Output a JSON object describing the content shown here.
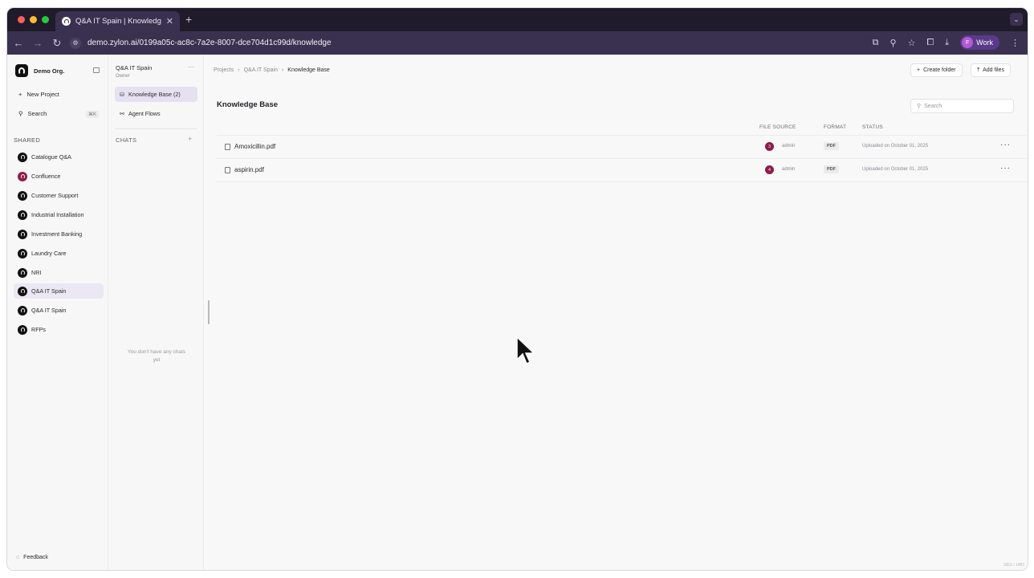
{
  "browser": {
    "tab_title": "Q&A IT Spain | Knowledge Ba",
    "url": "demo.zylon.ai/0199a05c-ac8c-7a2e-8007-dce704d1c99d/knowledge",
    "profile_initial": "F",
    "profile_label": "Work"
  },
  "sidebar": {
    "org_name": "Demo Org.",
    "new_project": "New Project",
    "search": "Search",
    "search_shortcut": "⌘K",
    "section": "SHARED",
    "projects": [
      {
        "label": "Catalogue Q&A",
        "active": false
      },
      {
        "label": "Confluence",
        "active": false
      },
      {
        "label": "Customer Support",
        "active": false
      },
      {
        "label": "Industrial Installation",
        "active": false
      },
      {
        "label": "Investment Banking",
        "active": false
      },
      {
        "label": "Laundry Care",
        "active": false
      },
      {
        "label": "NRI",
        "active": false
      },
      {
        "label": "Q&A IT Spain",
        "active": true
      },
      {
        "label": "Q&A IT Spain",
        "active": false
      },
      {
        "label": "RFPs",
        "active": false
      }
    ],
    "feedback": "Feedback"
  },
  "project_panel": {
    "name": "Q&A IT Spain",
    "role": "Owner",
    "nav": [
      {
        "label": "Knowledge Base (2)",
        "active": true
      },
      {
        "label": "Agent Flows",
        "active": false
      }
    ],
    "chats_header": "CHATS",
    "empty_chats": "You don't have any chats yet"
  },
  "main": {
    "breadcrumb": [
      "Projects",
      "Q&A IT Spain",
      "Knowledge Base"
    ],
    "create_folder": "Create folder",
    "add_files": "Add files",
    "title": "Knowledge Base",
    "search_placeholder": "Search",
    "columns": [
      "FILE SOURCE",
      "FORMAT",
      "STATUS"
    ],
    "files": [
      {
        "name": "Amoxicillin.pdf",
        "source_initial": "3",
        "source": "admin",
        "format": "PDF",
        "status": "Uploaded on October 01, 2025"
      },
      {
        "name": "aspirin.pdf",
        "source_initial": "4",
        "source": "admin",
        "format": "PDF",
        "status": "Uploaded on October 01, 2025"
      }
    ],
    "footer_counter": "1853 / 1483"
  }
}
